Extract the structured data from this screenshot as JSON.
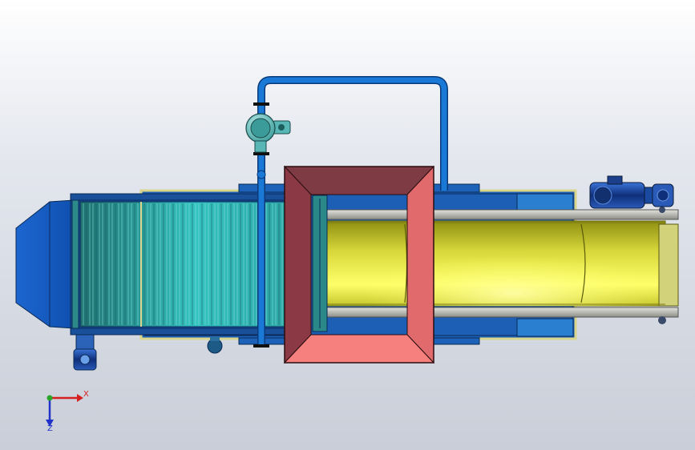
{
  "viewport": {
    "background_top": "#ffffff",
    "background_bottom": "#c9ced8"
  },
  "model": {
    "components": [
      "hopper",
      "mesh-conveyor",
      "belt-conveyor",
      "feed-chute",
      "water-pipe",
      "pump",
      "drive-motor",
      "gear-motor"
    ],
    "colors": {
      "hopper": "#1560c9",
      "mesh": "#2aa6a8",
      "chute_outer": "#8b3a45",
      "chute_inner": "#f07d7b",
      "belt_yellow": "#c9c92a",
      "pipe": "#1a78d6",
      "pump": "#58b7b5",
      "frame": "#d9d58a",
      "rails": "#b7b7b2"
    }
  },
  "triad": {
    "x_label": "X",
    "y_label": "Z",
    "x_color": "#d62020",
    "y_color": "#2232c8",
    "origin_color": "#2aa52a"
  }
}
